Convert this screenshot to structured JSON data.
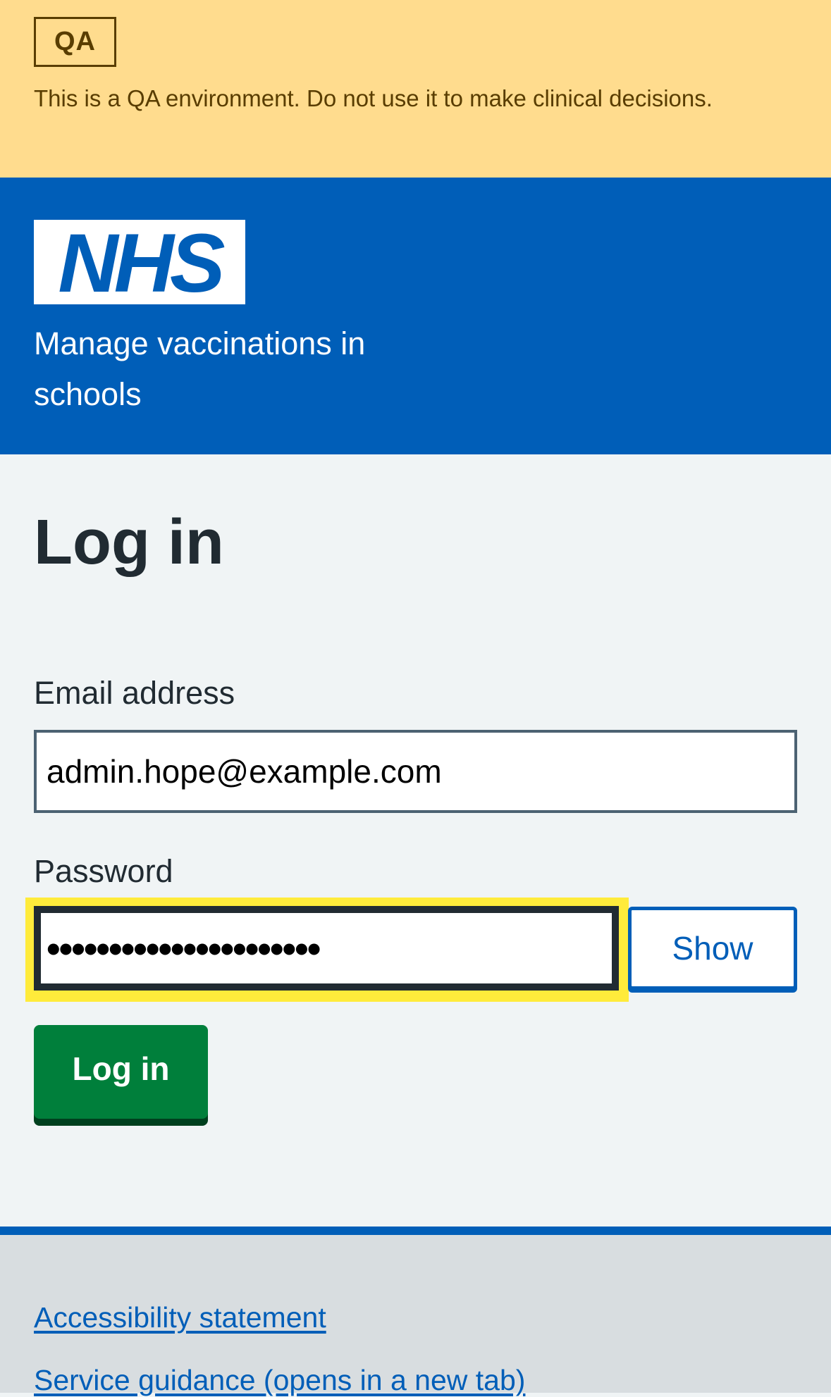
{
  "qa_banner": {
    "tag": "QA",
    "message": "This is a QA environment. Do not use it to make clinical decisions."
  },
  "header": {
    "logo_text": "NHS",
    "service_name": "Manage vaccinations in schools"
  },
  "main": {
    "title": "Log in",
    "email": {
      "label": "Email address",
      "value": "admin.hope@example.com"
    },
    "password": {
      "label": "Password",
      "masked_value": "••••••••••••••••••••••",
      "show_label": "Show"
    },
    "submit_label": "Log in"
  },
  "footer": {
    "links": [
      {
        "label": "Accessibility statement"
      },
      {
        "label": "Service guidance (opens in a new tab)"
      }
    ]
  },
  "colors": {
    "nhs_blue": "#005eb8",
    "qa_banner": "#ffdc8e",
    "button_green": "#007f3b",
    "focus_yellow": "#ffeb3b"
  }
}
